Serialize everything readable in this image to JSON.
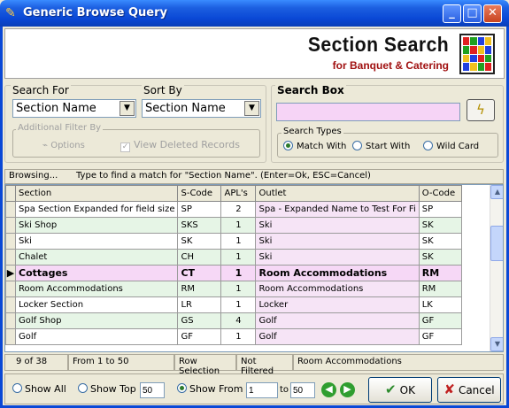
{
  "window": {
    "title": "Generic Browse Query",
    "min_glyph": "_",
    "max_glyph": "□",
    "close_glyph": "✕"
  },
  "banner": {
    "title": "Section Search",
    "subtitle": "for Banquet & Catering",
    "logo_colors": [
      "#e02020",
      "#20a020",
      "#2040e0",
      "#f0c020",
      "#20a020",
      "#e02020",
      "#f0c020",
      "#2040e0",
      "#f0c020",
      "#2040e0",
      "#e02020",
      "#20a020",
      "#2040e0",
      "#f0c020",
      "#20a020",
      "#e02020"
    ]
  },
  "search_for": {
    "label": "Search For",
    "value": "Section Name"
  },
  "sort_by": {
    "label": "Sort By",
    "value": "Section Name"
  },
  "additional_filter": {
    "label": "Additional Filter By",
    "options_label": "Options",
    "view_deleted_label": "View Deleted Records"
  },
  "search_box": {
    "label": "Search Box",
    "value": "",
    "search_button_icon": "lightning-icon",
    "types_label": "Search Types",
    "types": [
      "Match With",
      "Start With",
      "Wild Card"
    ],
    "selected_type": "Match With"
  },
  "browsing": {
    "label": "Browsing...",
    "hint": "Type to find a match for \"Section Name\". (Enter=Ok, ESC=Cancel)"
  },
  "grid": {
    "columns": [
      "Section",
      "S-Code",
      "APL's",
      "Outlet",
      "O-Code"
    ],
    "rows": [
      {
        "section": "Spa Section Expanded for field size",
        "scode": "SP",
        "apls": "2",
        "outlet": "Spa - Expanded Name to Test For Fi",
        "ocode": "SP",
        "bg": "#ffffff"
      },
      {
        "section": "Ski Shop",
        "scode": "SKS",
        "apls": "1",
        "outlet": "Ski",
        "ocode": "SK",
        "bg": "#e6f5e6"
      },
      {
        "section": "Ski",
        "scode": "SK",
        "apls": "1",
        "outlet": "Ski",
        "ocode": "SK",
        "bg": "#ffffff"
      },
      {
        "section": "Chalet",
        "scode": "CH",
        "apls": "1",
        "outlet": "Ski",
        "ocode": "SK",
        "bg": "#e6f5e6"
      },
      {
        "section": "Cottages",
        "scode": "CT",
        "apls": "1",
        "outlet": "Room Accommodations",
        "ocode": "RM",
        "bg": "#f6d8f6",
        "current": true
      },
      {
        "section": "Room Accommodations",
        "scode": "RM",
        "apls": "1",
        "outlet": "Room Accommodations",
        "ocode": "RM",
        "bg": "#e6f5e6"
      },
      {
        "section": "Locker Section",
        "scode": "LR",
        "apls": "1",
        "outlet": "Locker",
        "ocode": "LK",
        "bg": "#ffffff"
      },
      {
        "section": "Golf Shop",
        "scode": "GS",
        "apls": "4",
        "outlet": "Golf",
        "ocode": "GF",
        "bg": "#e6f5e6"
      },
      {
        "section": "Golf",
        "scode": "GF",
        "apls": "1",
        "outlet": "Golf",
        "ocode": "GF",
        "bg": "#ffffff"
      }
    ],
    "outlet_bg": "#f6e4f6"
  },
  "status": {
    "count": "9 of 38",
    "range": "From 1 to 50",
    "selection": "Row Selection",
    "filter": "Not Filtered",
    "outlet": "Room Accommodations"
  },
  "footer": {
    "show_all": "Show All",
    "show_top": "Show Top",
    "show_top_value": "50",
    "show_from": "Show From",
    "from_value": "1",
    "to_label": "to",
    "to_value": "50",
    "ok_label": "OK",
    "cancel_label": "Cancel"
  }
}
